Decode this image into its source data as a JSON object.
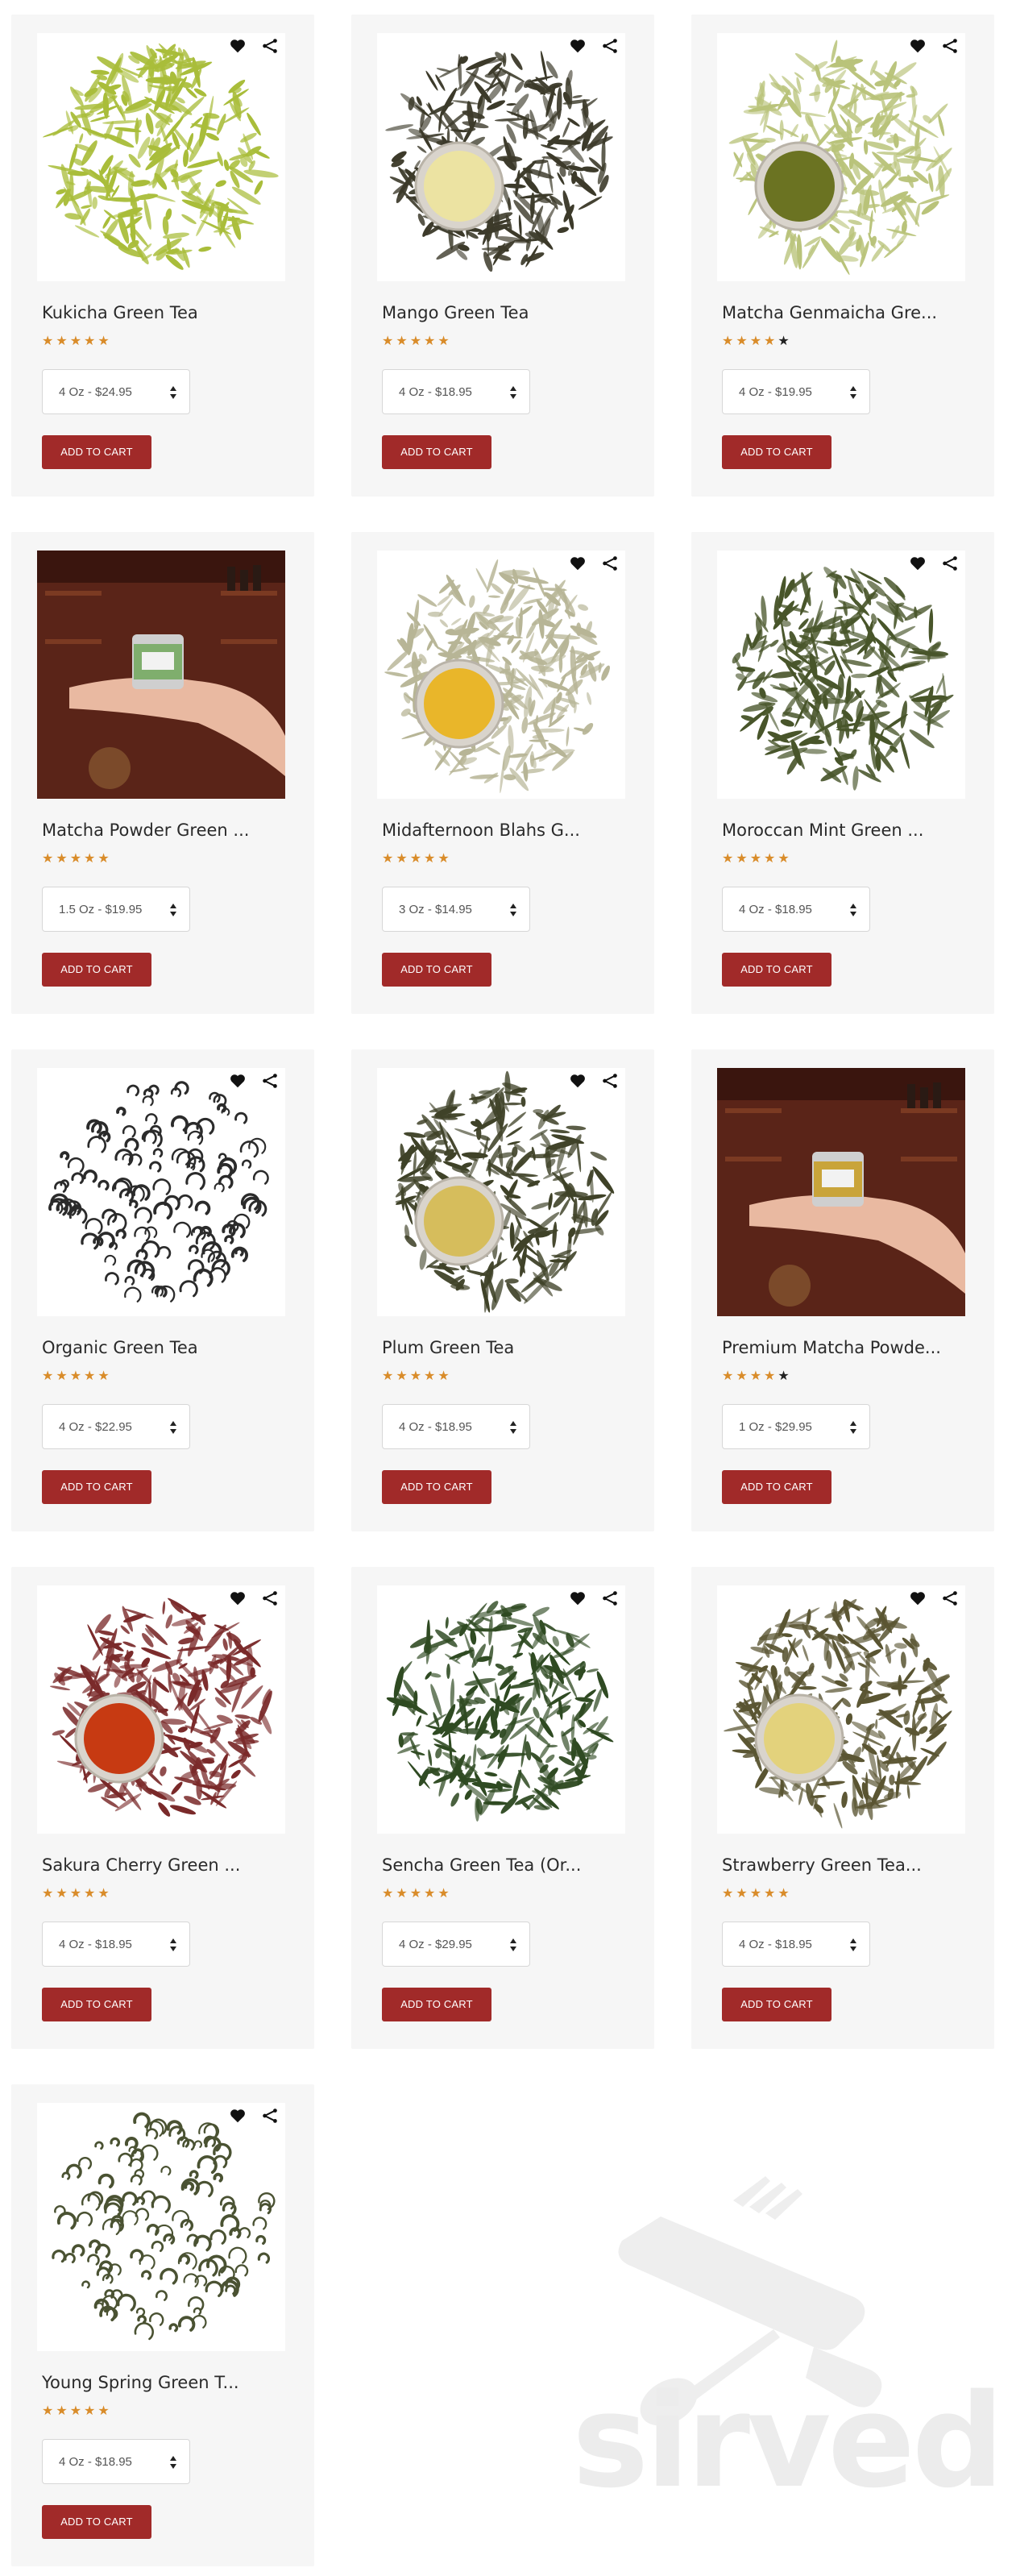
{
  "add_to_cart_label": "ADD TO CART",
  "colors": {
    "accent": "#a12a29",
    "star": "#d98c2a",
    "card_bg": "#f6f6f6"
  },
  "icons": {
    "wishlist": "heart-icon",
    "compare": "share-icon",
    "select": "sort-arrows-icon",
    "star": "star-icon"
  },
  "watermark": {
    "text": "sirved"
  },
  "products": [
    {
      "name": "Kukicha Green Tea",
      "rating": 5,
      "option": "4 Oz - $24.95",
      "image": "leaves",
      "leaf": "#a9bd3a",
      "cup": null,
      "actions": true
    },
    {
      "name": "Mango Green Tea",
      "rating": 5,
      "option": "4 Oz - $18.95",
      "image": "leaves",
      "leaf": "#3c3a2a",
      "cup": "#ece3a2",
      "actions": true
    },
    {
      "name": "Matcha Genmaicha Gre...",
      "rating": 4,
      "option": "4 Oz - $19.95",
      "image": "leaves",
      "leaf": "#b9c37a",
      "cup": "#6b7322",
      "actions": true
    },
    {
      "name": "Matcha Powder Green ...",
      "rating": 5,
      "option": "1.5 Oz - $19.95",
      "image": "photo",
      "tin": "#7fae6d",
      "actions": false
    },
    {
      "name": "Midafternoon Blahs G...",
      "rating": 5,
      "option": "3 Oz - $14.95",
      "image": "leaves",
      "leaf": "#b7b596",
      "cup": "#e9b62a",
      "actions": true
    },
    {
      "name": "Moroccan Mint Green ...",
      "rating": 5,
      "option": "4 Oz - $18.95",
      "image": "leaves",
      "leaf": "#48552a",
      "cup": null,
      "actions": true
    },
    {
      "name": "Organic Green Tea",
      "rating": 5,
      "option": "4 Oz - $22.95",
      "image": "curls",
      "leaf": "#2b2b2b",
      "cup": null,
      "actions": true
    },
    {
      "name": "Plum Green Tea",
      "rating": 5,
      "option": "4 Oz - $18.95",
      "image": "leaves",
      "leaf": "#3f4228",
      "cup": "#d6bd5c",
      "actions": true
    },
    {
      "name": "Premium Matcha Powde...",
      "rating": 4,
      "option": "1 Oz - $29.95",
      "image": "photo",
      "tin": "#c9a43a",
      "actions": false
    },
    {
      "name": "Sakura Cherry Green ...",
      "rating": 5,
      "option": "4 Oz - $18.95",
      "image": "leaves",
      "leaf": "#7a2a2a",
      "cup": "#c73a12",
      "actions": true
    },
    {
      "name": "Sencha Green Tea (Or...",
      "rating": 5,
      "option": "4 Oz - $29.95",
      "image": "leaves",
      "leaf": "#2f4a22",
      "cup": null,
      "actions": true
    },
    {
      "name": "Strawberry Green Tea...",
      "rating": 5,
      "option": "4 Oz - $18.95",
      "image": "leaves",
      "leaf": "#5a5532",
      "cup": "#e3d27c",
      "actions": true
    },
    {
      "name": "Young Spring Green T...",
      "rating": 5,
      "option": "4 Oz - $18.95",
      "image": "curls",
      "leaf": "#4a5232",
      "cup": null,
      "actions": true
    }
  ]
}
